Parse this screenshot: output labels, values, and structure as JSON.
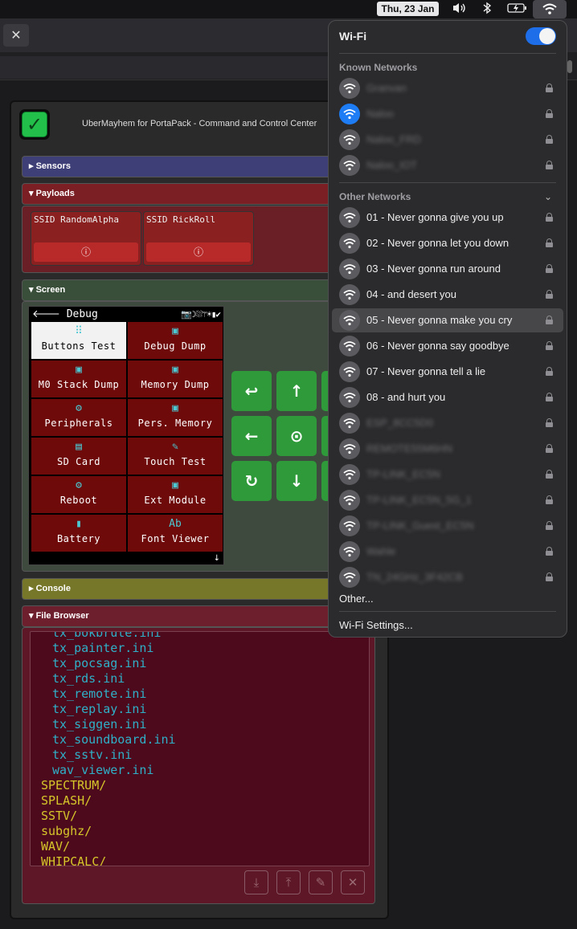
{
  "menubar": {
    "date": "Thu, 23 Jan",
    "volume_icon": "volume-icon",
    "bluetooth_icon": "bluetooth-icon",
    "battery_icon": "battery-icon",
    "wifi_icon": "wifi-icon"
  },
  "browser": {
    "close_label": "✕"
  },
  "app": {
    "check_label": "✓",
    "title": "UberMayhem for PortaPack - Command and Control Center",
    "sections": {
      "sensors": "Sensors",
      "payloads": "Payloads",
      "screen": "Screen",
      "console": "Console",
      "file_browser": "File Browser"
    },
    "colors": {
      "sensors": "#3f3f77",
      "payloads": "#7b1f24",
      "screen": "#3a4f3a",
      "console": "#77772a",
      "file_browser": "#6e1f2e"
    },
    "payloads": [
      {
        "label": "SSID RandomAlpha",
        "button": "ⓘ"
      },
      {
        "label": "SSID RickRoll",
        "button": "ⓘ"
      }
    ],
    "screen": {
      "title_arrow": "🡐",
      "title": "Debug",
      "status_icons": "📷☽⛆⚚☀▮✔",
      "tiles": [
        {
          "label": "Buttons Test",
          "icon": "⠿",
          "selected": true
        },
        {
          "label": "Debug Dump",
          "icon": "▣",
          "selected": false
        },
        {
          "label": "M0 Stack Dump",
          "icon": "▣",
          "selected": false
        },
        {
          "label": "Memory Dump",
          "icon": "▣",
          "selected": false
        },
        {
          "label": "Peripherals",
          "icon": "⚙",
          "selected": false
        },
        {
          "label": "Pers. Memory",
          "icon": "▣",
          "selected": false
        },
        {
          "label": "SD Card",
          "icon": "▤",
          "selected": false
        },
        {
          "label": "Touch Test",
          "icon": "✎",
          "selected": false
        },
        {
          "label": "Reboot",
          "icon": "⚙",
          "selected": false
        },
        {
          "label": "Ext Module",
          "icon": "▣",
          "selected": false
        },
        {
          "label": "Battery",
          "icon": "▮",
          "selected": false
        },
        {
          "label": "Font Viewer",
          "icon": "Ab",
          "selected": false
        }
      ],
      "scroll_hint": "↓"
    },
    "dpad": {
      "enter": "↩",
      "up": "↑",
      "left": "←",
      "select": "⊙",
      "rotate": "↻",
      "down": "↓"
    },
    "files": [
      {
        "name": "tx_bokbrute.ini",
        "type": "file"
      },
      {
        "name": "tx_painter.ini",
        "type": "file"
      },
      {
        "name": "tx_pocsag.ini",
        "type": "file"
      },
      {
        "name": "tx_rds.ini",
        "type": "file"
      },
      {
        "name": "tx_remote.ini",
        "type": "file"
      },
      {
        "name": "tx_replay.ini",
        "type": "file"
      },
      {
        "name": "tx_siggen.ini",
        "type": "file"
      },
      {
        "name": "tx_soundboard.ini",
        "type": "file"
      },
      {
        "name": "tx_sstv.ini",
        "type": "file"
      },
      {
        "name": "wav_viewer.ini",
        "type": "file"
      },
      {
        "name": "SPECTRUM/",
        "type": "dir"
      },
      {
        "name": "SPLASH/",
        "type": "dir"
      },
      {
        "name": "SSTV/",
        "type": "dir"
      },
      {
        "name": "subghz/",
        "type": "dir"
      },
      {
        "name": "WAV/",
        "type": "dir"
      },
      {
        "name": "WHIPCALC/",
        "type": "dir"
      }
    ],
    "file_buttons": {
      "download": "⤓",
      "upload": "⤒",
      "edit": "✎",
      "delete": "✕"
    }
  },
  "wifi": {
    "title": "Wi-Fi",
    "enabled": true,
    "known_header": "Known Networks",
    "other_header": "Other Networks",
    "known": [
      {
        "name": "Granvan",
        "connected": false
      },
      {
        "name": "Naloo",
        "connected": true
      },
      {
        "name": "Naloo_FRD",
        "connected": false
      },
      {
        "name": "Naloo_IOT",
        "connected": false
      }
    ],
    "other": [
      {
        "name": "01 - Never gonna give you up",
        "blurred": false,
        "highlighted": false
      },
      {
        "name": "02 - Never gonna let you down",
        "blurred": false,
        "highlighted": false
      },
      {
        "name": "03 - Never gonna run around",
        "blurred": false,
        "highlighted": false
      },
      {
        "name": "04 - and desert you",
        "blurred": false,
        "highlighted": false
      },
      {
        "name": "05 - Never gonna make you cry",
        "blurred": false,
        "highlighted": true
      },
      {
        "name": "06 - Never gonna say goodbye",
        "blurred": false,
        "highlighted": false
      },
      {
        "name": "07 - Never gonna tell a lie",
        "blurred": false,
        "highlighted": false
      },
      {
        "name": "08 - and hurt you",
        "blurred": false,
        "highlighted": false
      },
      {
        "name": "ESP_8CC5D0",
        "blurred": true,
        "highlighted": false
      },
      {
        "name": "REMOTE55M6HN",
        "blurred": true,
        "highlighted": false
      },
      {
        "name": "TP-LINK_EC5N",
        "blurred": true,
        "highlighted": false
      },
      {
        "name": "TP-LINK_EC5N_5G_1",
        "blurred": true,
        "highlighted": false
      },
      {
        "name": "TP-LINK_Guest_EC5N",
        "blurred": true,
        "highlighted": false
      },
      {
        "name": "Wahle",
        "blurred": true,
        "highlighted": false
      },
      {
        "name": "TN_24GHz_3F42CB",
        "blurred": true,
        "highlighted": false
      }
    ],
    "other_link": "Other...",
    "settings_link": "Wi-Fi Settings..."
  }
}
